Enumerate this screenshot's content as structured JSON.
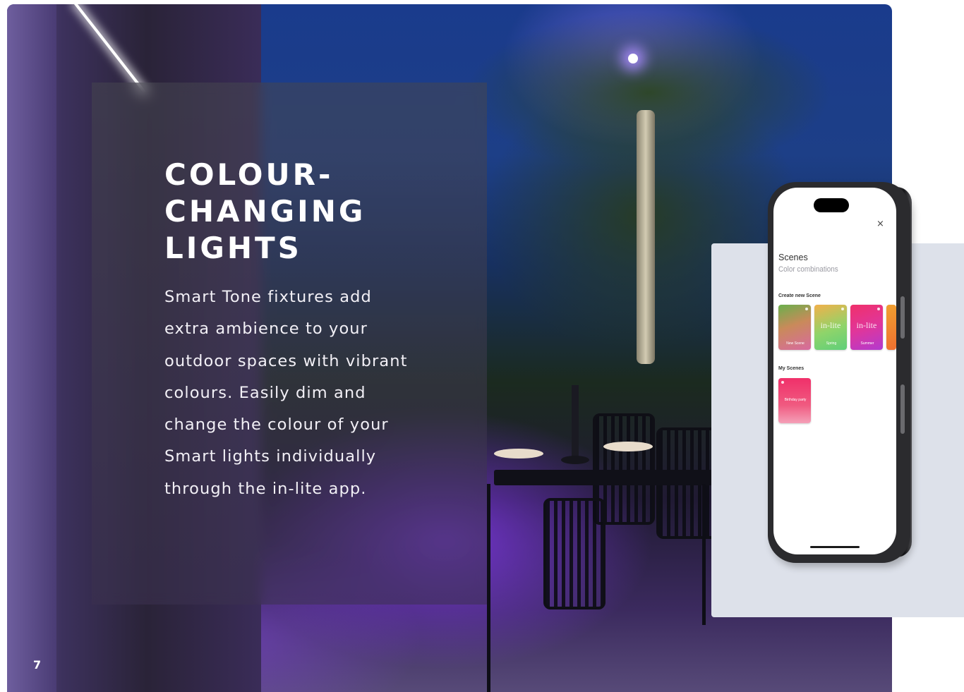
{
  "article": {
    "heading": "COLOUR-\nCHANGING\nLIGHTS",
    "body": "Smart Tone fixtures add extra ambience to your outdoor spaces with vibrant colours. Easily dim and change the colour of your Smart lights individually through the in-lite app."
  },
  "page_number": "7",
  "phone_app": {
    "close_label": "×",
    "title": "Scenes",
    "subtitle": "Color combinations",
    "create_section_label": "Create new Scene",
    "my_scenes_label": "My Scenes",
    "scene_tiles": [
      {
        "logo": "",
        "label": "New Scene"
      },
      {
        "logo": "in-lite",
        "label": "Spring"
      },
      {
        "logo": "in-lite",
        "label": "Summer"
      }
    ],
    "my_scene_tiles": [
      {
        "label": "Birthday party"
      }
    ]
  },
  "colors": {
    "panel_grey": "#dde1ea",
    "tile_new": "#c98a5a",
    "tile_spring": "#8fd46a",
    "tile_summer": "#e0369a",
    "tile_birthday": "#f0406a"
  }
}
